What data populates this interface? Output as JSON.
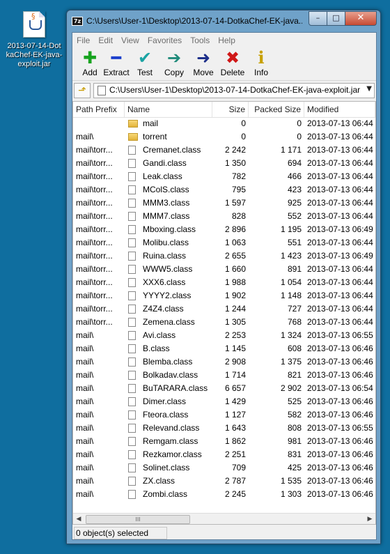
{
  "desktop": {
    "icon_label": "2013-07-14-DotkaChef-EK-java-exploit.jar"
  },
  "window": {
    "app_icon": "7z",
    "title": "C:\\Users\\User-1\\Desktop\\2013-07-14-DotkaChef-EK-java...",
    "minimize": "–",
    "maximize": "□",
    "close": "✕"
  },
  "menu": [
    "File",
    "Edit",
    "View",
    "Favorites",
    "Tools",
    "Help"
  ],
  "toolbar": [
    {
      "label": "Add",
      "icon": "plus-icon",
      "glyph": "✚"
    },
    {
      "label": "Extract",
      "icon": "minus-icon",
      "glyph": "━"
    },
    {
      "label": "Test",
      "icon": "check-icon",
      "glyph": "✔"
    },
    {
      "label": "Copy",
      "icon": "arrow-right-icon",
      "glyph": "➔"
    },
    {
      "label": "Move",
      "icon": "arrow-right-icon",
      "glyph": "➜"
    },
    {
      "label": "Delete",
      "icon": "x-icon",
      "glyph": "✖"
    },
    {
      "label": "Info",
      "icon": "info-icon",
      "glyph": "i"
    }
  ],
  "address": {
    "path": "C:\\Users\\User-1\\Desktop\\2013-07-14-DotkaChef-EK-java-exploit.jar\\"
  },
  "columns": [
    "Path Prefix",
    "Name",
    "Size",
    "Packed Size",
    "Modified"
  ],
  "rows": [
    {
      "prefix": "",
      "name": "mail",
      "size": "0",
      "packed": "0",
      "modified": "2013-07-13 06:44",
      "type": "folder"
    },
    {
      "prefix": "mail\\",
      "name": "torrent",
      "size": "0",
      "packed": "0",
      "modified": "2013-07-13 06:44",
      "type": "folder"
    },
    {
      "prefix": "mail\\torr...",
      "name": "Cremanet.class",
      "size": "2 242",
      "packed": "1 171",
      "modified": "2013-07-13 06:44",
      "type": "file"
    },
    {
      "prefix": "mail\\torr...",
      "name": "Gandi.class",
      "size": "1 350",
      "packed": "694",
      "modified": "2013-07-13 06:44",
      "type": "file"
    },
    {
      "prefix": "mail\\torr...",
      "name": "Leak.class",
      "size": "782",
      "packed": "466",
      "modified": "2013-07-13 06:44",
      "type": "file"
    },
    {
      "prefix": "mail\\torr...",
      "name": "MColS.class",
      "size": "795",
      "packed": "423",
      "modified": "2013-07-13 06:44",
      "type": "file"
    },
    {
      "prefix": "mail\\torr...",
      "name": "MMM3.class",
      "size": "1 597",
      "packed": "925",
      "modified": "2013-07-13 06:44",
      "type": "file"
    },
    {
      "prefix": "mail\\torr...",
      "name": "MMM7.class",
      "size": "828",
      "packed": "552",
      "modified": "2013-07-13 06:44",
      "type": "file"
    },
    {
      "prefix": "mail\\torr...",
      "name": "Mboxing.class",
      "size": "2 896",
      "packed": "1 195",
      "modified": "2013-07-13 06:49",
      "type": "file"
    },
    {
      "prefix": "mail\\torr...",
      "name": "Molibu.class",
      "size": "1 063",
      "packed": "551",
      "modified": "2013-07-13 06:44",
      "type": "file"
    },
    {
      "prefix": "mail\\torr...",
      "name": "Ruina.class",
      "size": "2 655",
      "packed": "1 423",
      "modified": "2013-07-13 06:49",
      "type": "file"
    },
    {
      "prefix": "mail\\torr...",
      "name": "WWW5.class",
      "size": "1 660",
      "packed": "891",
      "modified": "2013-07-13 06:44",
      "type": "file"
    },
    {
      "prefix": "mail\\torr...",
      "name": "XXX6.class",
      "size": "1 988",
      "packed": "1 054",
      "modified": "2013-07-13 06:44",
      "type": "file"
    },
    {
      "prefix": "mail\\torr...",
      "name": "YYYY2.class",
      "size": "1 902",
      "packed": "1 148",
      "modified": "2013-07-13 06:44",
      "type": "file"
    },
    {
      "prefix": "mail\\torr...",
      "name": "Z4Z4.class",
      "size": "1 244",
      "packed": "727",
      "modified": "2013-07-13 06:44",
      "type": "file"
    },
    {
      "prefix": "mail\\torr...",
      "name": "Zemena.class",
      "size": "1 305",
      "packed": "768",
      "modified": "2013-07-13 06:44",
      "type": "file"
    },
    {
      "prefix": "mail\\",
      "name": "Avi.class",
      "size": "2 253",
      "packed": "1 324",
      "modified": "2013-07-13 06:55",
      "type": "file"
    },
    {
      "prefix": "mail\\",
      "name": "B.class",
      "size": "1 145",
      "packed": "608",
      "modified": "2013-07-13 06:46",
      "type": "file"
    },
    {
      "prefix": "mail\\",
      "name": "Blemba.class",
      "size": "2 908",
      "packed": "1 375",
      "modified": "2013-07-13 06:46",
      "type": "file"
    },
    {
      "prefix": "mail\\",
      "name": "Bolkadav.class",
      "size": "1 714",
      "packed": "821",
      "modified": "2013-07-13 06:46",
      "type": "file"
    },
    {
      "prefix": "mail\\",
      "name": "BuTARARA.class",
      "size": "6 657",
      "packed": "2 902",
      "modified": "2013-07-13 06:54",
      "type": "file"
    },
    {
      "prefix": "mail\\",
      "name": "Dimer.class",
      "size": "1 429",
      "packed": "525",
      "modified": "2013-07-13 06:46",
      "type": "file"
    },
    {
      "prefix": "mail\\",
      "name": "Fteora.class",
      "size": "1 127",
      "packed": "582",
      "modified": "2013-07-13 06:46",
      "type": "file"
    },
    {
      "prefix": "mail\\",
      "name": "Relevand.class",
      "size": "1 643",
      "packed": "808",
      "modified": "2013-07-13 06:55",
      "type": "file"
    },
    {
      "prefix": "mail\\",
      "name": "Remgam.class",
      "size": "1 862",
      "packed": "981",
      "modified": "2013-07-13 06:46",
      "type": "file"
    },
    {
      "prefix": "mail\\",
      "name": "Rezkamor.class",
      "size": "2 251",
      "packed": "831",
      "modified": "2013-07-13 06:46",
      "type": "file"
    },
    {
      "prefix": "mail\\",
      "name": "Solinet.class",
      "size": "709",
      "packed": "425",
      "modified": "2013-07-13 06:46",
      "type": "file"
    },
    {
      "prefix": "mail\\",
      "name": "ZX.class",
      "size": "2 787",
      "packed": "1 535",
      "modified": "2013-07-13 06:46",
      "type": "file"
    },
    {
      "prefix": "mail\\",
      "name": "Zombi.class",
      "size": "2 245",
      "packed": "1 303",
      "modified": "2013-07-13 06:46",
      "type": "file"
    }
  ],
  "status": {
    "text": "0 object(s) selected"
  },
  "colors": {
    "desktop": "#0f6e9f",
    "titlebar": "#6fa2c9",
    "close": "#c74a32"
  }
}
